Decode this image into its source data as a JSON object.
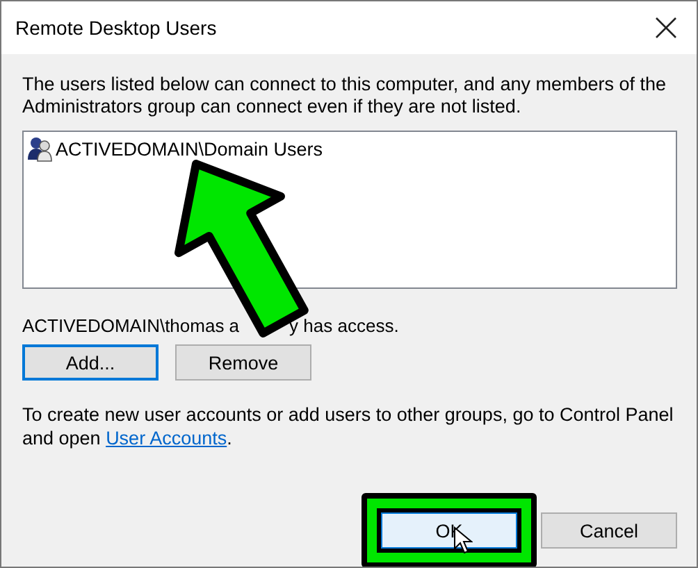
{
  "window": {
    "title": "Remote Desktop Users"
  },
  "description": "The users listed below can connect to this computer, and any members of the Administrators group can connect even if they are not listed.",
  "users": [
    {
      "name": "ACTIVEDOMAIN\\Domain Users",
      "selected": false
    }
  ],
  "access_text": [
    "ACTIVEDOMAIN\\thomas a",
    "y has access."
  ],
  "list_buttons": [
    {
      "label": "Add...",
      "focused": true
    },
    {
      "label": "Remove",
      "focused": false
    }
  ],
  "info": {
    "text": "To create new user accounts or add users to other groups, go to Control Panel and open ",
    "link": "User Accounts",
    "after": "."
  },
  "footer_buttons": [
    {
      "label": "OK",
      "focused": true,
      "highlighted": true
    },
    {
      "label": "Cancel",
      "focused": false,
      "highlighted": false
    }
  ],
  "annotations": [
    {
      "kind": "arrow"
    }
  ]
}
